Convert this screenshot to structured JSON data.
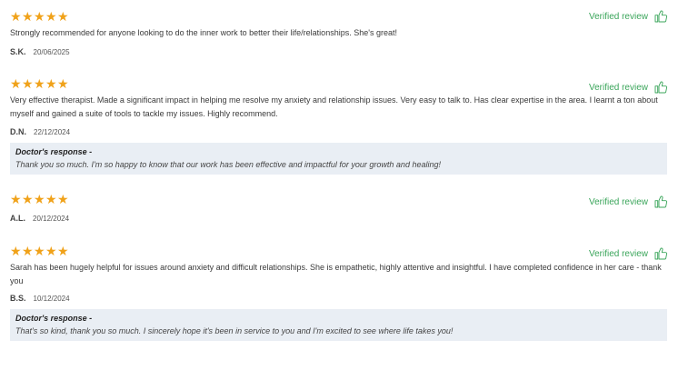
{
  "reviews": [
    {
      "rating": 5,
      "verified_label": "Verified review",
      "text": "Strongly recommended for anyone looking to do the inner work to better their life/relationships. She's great!",
      "initials": "S.K.",
      "date": "20/06/2025"
    },
    {
      "rating": 5,
      "verified_label": "Verified review",
      "text": "Very effective therapist. Made a significant impact in helping me resolve my anxiety and relationship issues. Very easy to talk to. Has clear expertise in the area. I learnt a ton about myself and gained a suite of tools to tackle my issues. Highly recommend.",
      "initials": "D.N.",
      "date": "22/12/2024",
      "response_title": "Doctor's response -",
      "response_text": "Thank you so much. I'm so happy to know that our work has been effective and impactful for your growth and healing!"
    },
    {
      "rating": 5,
      "verified_label": "Verified review",
      "initials": "A.L.",
      "date": "20/12/2024"
    },
    {
      "rating": 5,
      "verified_label": "Verified review",
      "text": "Sarah has been hugely helpful for issues around anxiety and difficult relationships. She is empathetic, highly attentive and insightful. I have completed confidence in her care - thank you",
      "initials": "B.S.",
      "date": "10/12/2024",
      "response_title": "Doctor's response -",
      "response_text": "That's so kind, thank you so much. I sincerely hope it's been in service to you and I'm excited to see where life takes you!"
    }
  ],
  "icons": {
    "star": "star-icon",
    "verified": "thumbs-up-icon"
  },
  "colors": {
    "star": "#f0a21a",
    "verified": "#3aa55a",
    "response_bg": "#e9eef4"
  }
}
